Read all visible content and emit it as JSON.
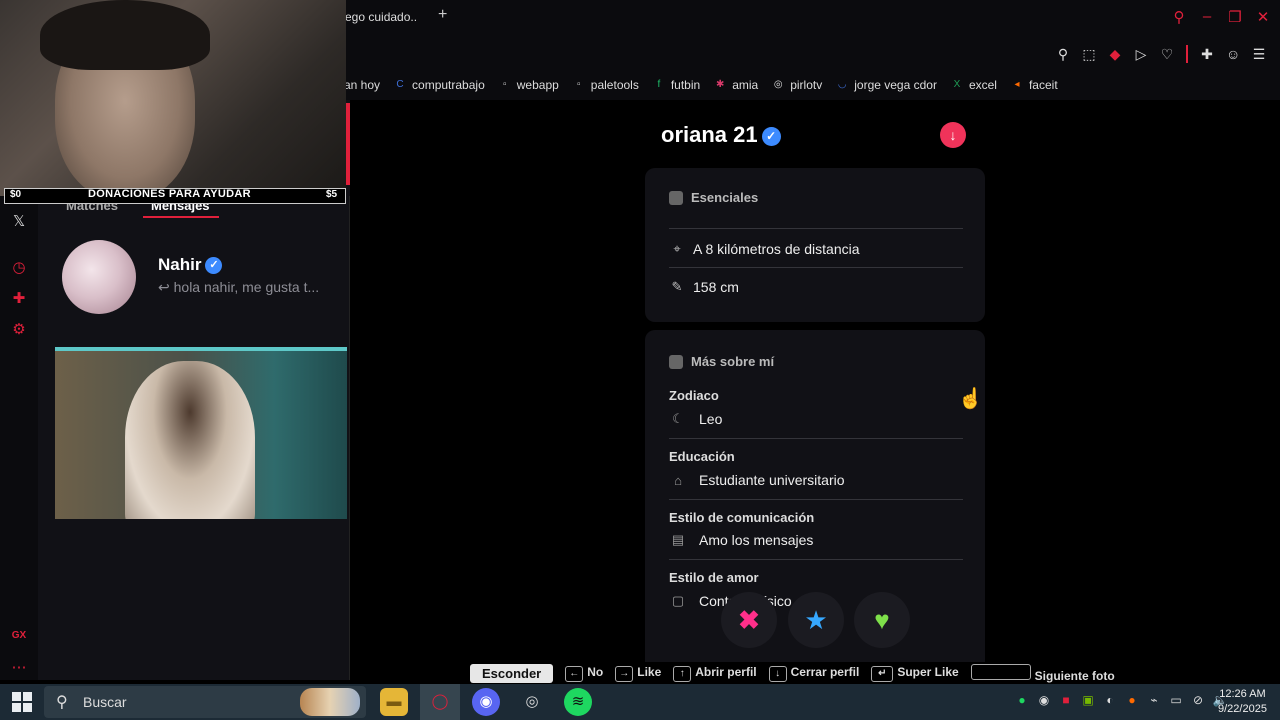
{
  "browser": {
    "tab_title": "ego cuidado..",
    "new_tab_label": "+",
    "bookmarks": [
      {
        "label": "an hoy",
        "icon": "",
        "color": ""
      },
      {
        "label": "computrabajo",
        "icon": "C",
        "color": "#3e6fd8"
      },
      {
        "label": "webapp",
        "icon": "▫",
        "color": "#cccccc"
      },
      {
        "label": "paletools",
        "icon": "▫",
        "color": "#cccccc"
      },
      {
        "label": "futbin",
        "icon": "f",
        "color": "#1fbf6a"
      },
      {
        "label": "amia",
        "icon": "✱",
        "color": "#d83a6a"
      },
      {
        "label": "pirlotv",
        "icon": "◎",
        "color": "#dddddd"
      },
      {
        "label": "jorge vega cdor",
        "icon": "◡",
        "color": "#3e6fd8"
      },
      {
        "label": "excel",
        "icon": "X",
        "color": "#1f9d55"
      },
      {
        "label": "faceit",
        "icon": "◂",
        "color": "#ff6a00"
      }
    ]
  },
  "stream": {
    "donation_left": "$0",
    "donation_text": "DONACIONES PARA AYUDAR",
    "donation_right": "$5"
  },
  "sidebar": {
    "tab_matches": "Matches",
    "tab_mensajes": "Mensajes",
    "message": {
      "name": "Nahir",
      "preview": "↩ hola nahir, me gusta t..."
    }
  },
  "profile": {
    "name": "oriana 21",
    "essentials_title": "Esenciales",
    "distance": "A 8 kilómetros de distancia",
    "height": "158 cm",
    "about_title": "Más sobre mí",
    "fields": [
      {
        "label": "Zodiaco",
        "value": "Leo",
        "icon": "☾"
      },
      {
        "label": "Educación",
        "value": "Estudiante universitario",
        "icon": "🎓"
      },
      {
        "label": "Estilo de comunicación",
        "value": "Amo los mensajes",
        "icon": "▤"
      },
      {
        "label": "Estilo de amor",
        "value": "Contacto físico",
        "icon": "▢"
      }
    ]
  },
  "actions": {
    "no": "✖",
    "super": "★",
    "like": "♥"
  },
  "hints": {
    "hide": "Esconder",
    "no": "No",
    "like": "Like",
    "open": "Abrir perfil",
    "close": "Cerrar perfil",
    "super": "Super Like",
    "next": "Siguiente foto"
  },
  "taskbar": {
    "search": "Buscar",
    "time": "12:26 AM",
    "date": "9/22/2025"
  },
  "colors": {
    "accent": "#e0203b",
    "verified": "#3d8bff",
    "like": "#7ee04a",
    "nope": "#ff2f8a",
    "super": "#36a8ff"
  }
}
